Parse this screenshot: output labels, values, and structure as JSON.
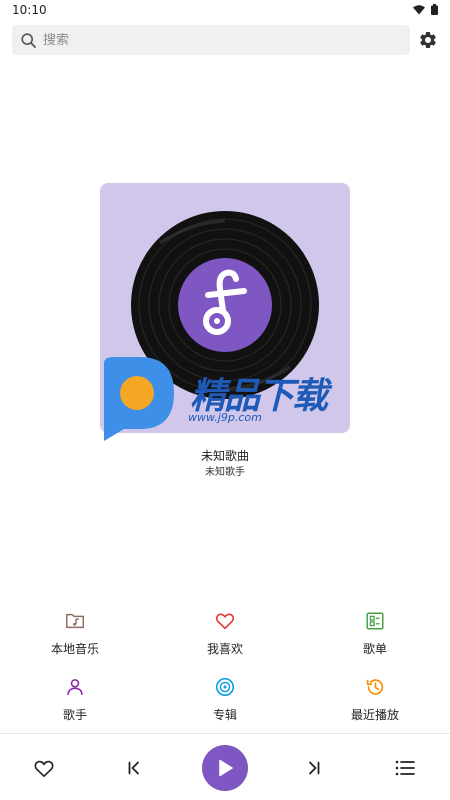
{
  "status_bar": {
    "time": "10:10"
  },
  "search": {
    "placeholder": "搜索"
  },
  "now_playing": {
    "title": "未知歌曲",
    "artist": "未知歌手"
  },
  "watermark": {
    "brand": "精品下载",
    "url": "www.j9p.com"
  },
  "menu": [
    {
      "label": "本地音乐",
      "icon": "folder-music-icon",
      "color": "#8d6e63"
    },
    {
      "label": "我喜欢",
      "icon": "heart-icon",
      "color": "#e53935"
    },
    {
      "label": "歌单",
      "icon": "playlist-icon",
      "color": "#43a047"
    },
    {
      "label": "歌手",
      "icon": "person-icon",
      "color": "#8e24aa"
    },
    {
      "label": "专辑",
      "icon": "album-icon",
      "color": "#039be5"
    },
    {
      "label": "最近播放",
      "icon": "history-icon",
      "color": "#fb8c00"
    }
  ],
  "colors": {
    "accent": "#7e57c2",
    "cover_bg": "#d1c7eb"
  }
}
